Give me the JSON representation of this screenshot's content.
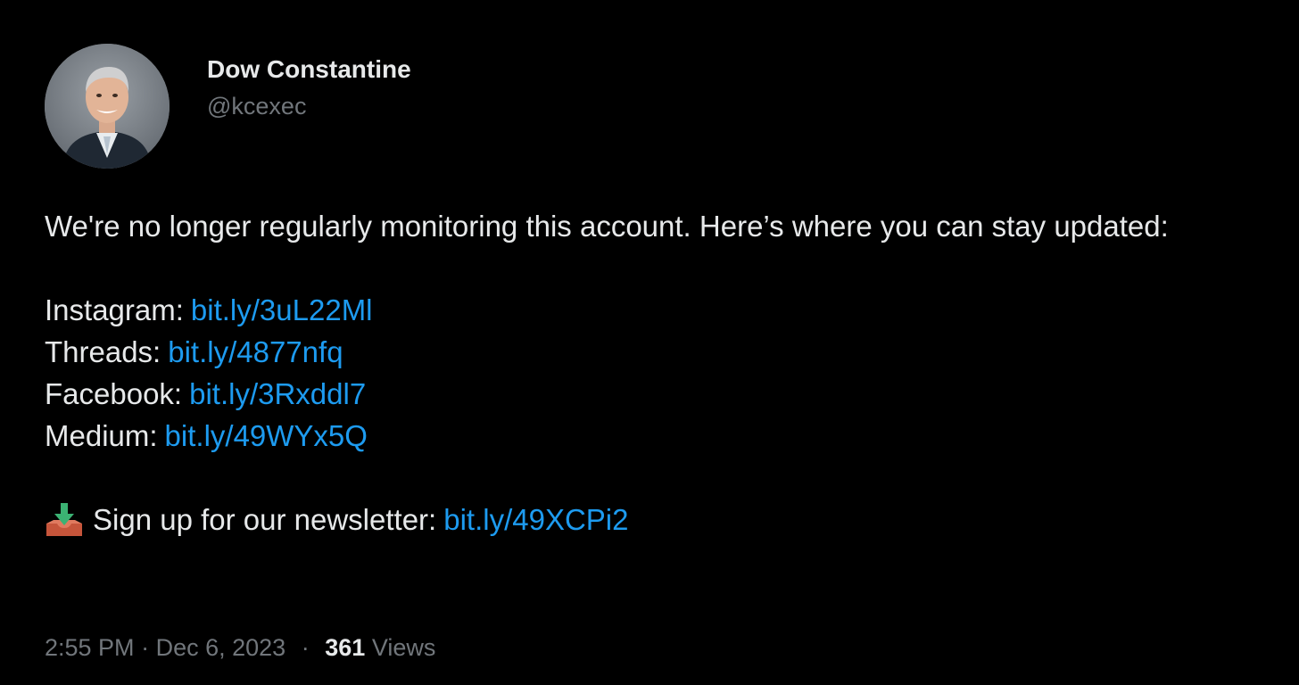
{
  "author": {
    "display_name": "Dow Constantine",
    "handle": "@kcexec"
  },
  "tweet": {
    "intro": "We're no longer regularly monitoring this account. Here’s where you can stay updated:",
    "links": [
      {
        "label": "Instagram:",
        "url": "bit.ly/3uL22Ml"
      },
      {
        "label": "Threads:",
        "url": "bit.ly/4877nfq"
      },
      {
        "label": "Facebook:",
        "url": "bit.ly/3Rxddl7"
      },
      {
        "label": "Medium:",
        "url": "bit.ly/49WYx5Q"
      }
    ],
    "newsletter": {
      "icon": "inbox-tray-icon",
      "label": "Sign up for our newsletter:",
      "url": "bit.ly/49XCPi2"
    }
  },
  "footer": {
    "time": "2:55 PM",
    "separator": "·",
    "date": "Dec 6, 2023",
    "views_count": "361",
    "views_label": "Views"
  },
  "colors": {
    "background": "#000000",
    "text": "#e7e9ea",
    "muted": "#71767b",
    "link": "#1d9bf0"
  }
}
